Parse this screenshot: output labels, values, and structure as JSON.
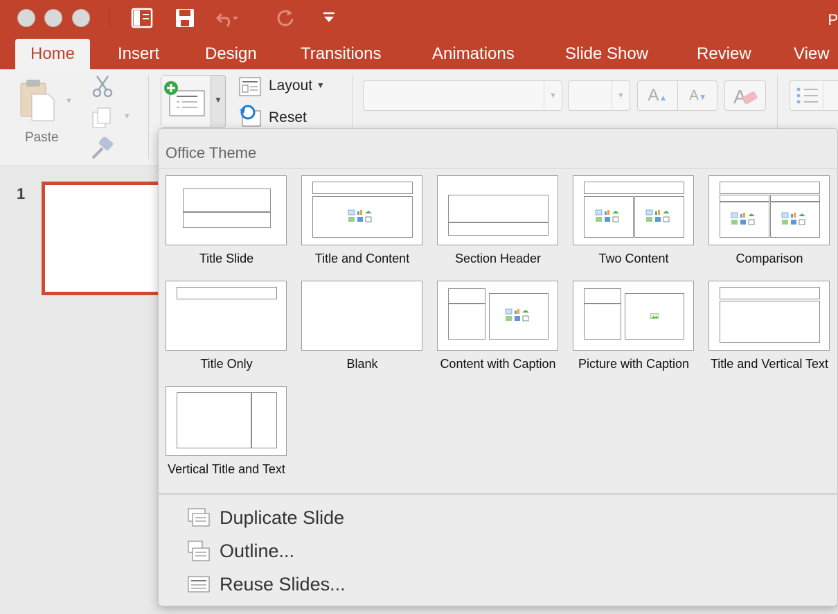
{
  "window": {
    "title_fragment": "P"
  },
  "tabs": [
    {
      "label": "Home",
      "active": true
    },
    {
      "label": "Insert"
    },
    {
      "label": "Design"
    },
    {
      "label": "Transitions"
    },
    {
      "label": "Animations"
    },
    {
      "label": "Slide Show"
    },
    {
      "label": "Review"
    },
    {
      "label": "View"
    }
  ],
  "ribbon": {
    "paste_label": "Paste",
    "layout_label": "Layout",
    "reset_label": "Reset"
  },
  "thumbnails": {
    "slide_number": "1"
  },
  "gallery": {
    "title": "Office Theme",
    "layouts": [
      {
        "label": "Title Slide"
      },
      {
        "label": "Title and Content"
      },
      {
        "label": "Section Header"
      },
      {
        "label": "Two Content"
      },
      {
        "label": "Comparison"
      },
      {
        "label": "Title Only"
      },
      {
        "label": "Blank"
      },
      {
        "label": "Content with Caption"
      },
      {
        "label": "Picture with Caption"
      },
      {
        "label": "Title and Vertical Text"
      },
      {
        "label": "Vertical Title and Text"
      }
    ],
    "commands": [
      {
        "label": "Duplicate Slide",
        "icon": "duplicate-slide-icon"
      },
      {
        "label": "Outline...",
        "icon": "outline-icon"
      },
      {
        "label": "Reuse Slides...",
        "icon": "reuse-slides-icon"
      }
    ]
  },
  "colors": {
    "accent": "#c2432b",
    "selected_border": "#d04a32"
  }
}
